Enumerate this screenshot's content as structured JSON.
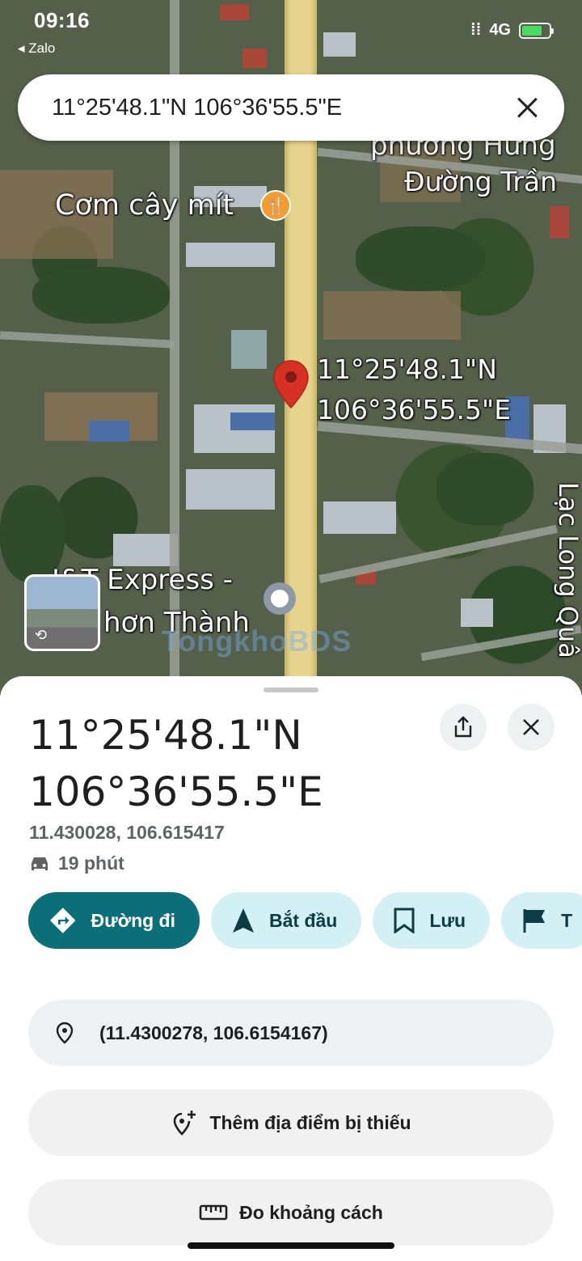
{
  "status_bar": {
    "time": "09:16",
    "back_app": "◂ Zalo",
    "network": "4G"
  },
  "search": {
    "query": "11°25'48.1\"N 106°36'55.5\"E"
  },
  "map": {
    "labels": {
      "restaurant": "Cơm cây mít",
      "street_top": "Đường Trần",
      "ward_partial": "phường Hưng",
      "pin_lat": "11°25'48.1\"N",
      "pin_lng": "106°36'55.5\"E",
      "express_line1": "J&T Express -",
      "express_line2": "hơn Thành",
      "street_right": "Lạc Long Quâ"
    },
    "watermark": "TongkhoBDS"
  },
  "place": {
    "title_line1": "11°25'48.1\"N",
    "title_line2": "106°36'55.5\"E",
    "decimal_coords": "11.430028, 106.615417",
    "drive_time": "19 phút"
  },
  "actions": {
    "directions": "Đường đi",
    "start": "Bắt đầu",
    "save": "Lưu",
    "more_partial": "T"
  },
  "rows": {
    "coordinates": "(11.4300278, 106.6154167)",
    "add_missing": "Thêm địa điểm bị thiếu",
    "measure": "Đo khoảng cách"
  },
  "colors": {
    "primary": "#0b6e79",
    "chip_light": "#d3f1f4",
    "pin": "#d93025"
  }
}
